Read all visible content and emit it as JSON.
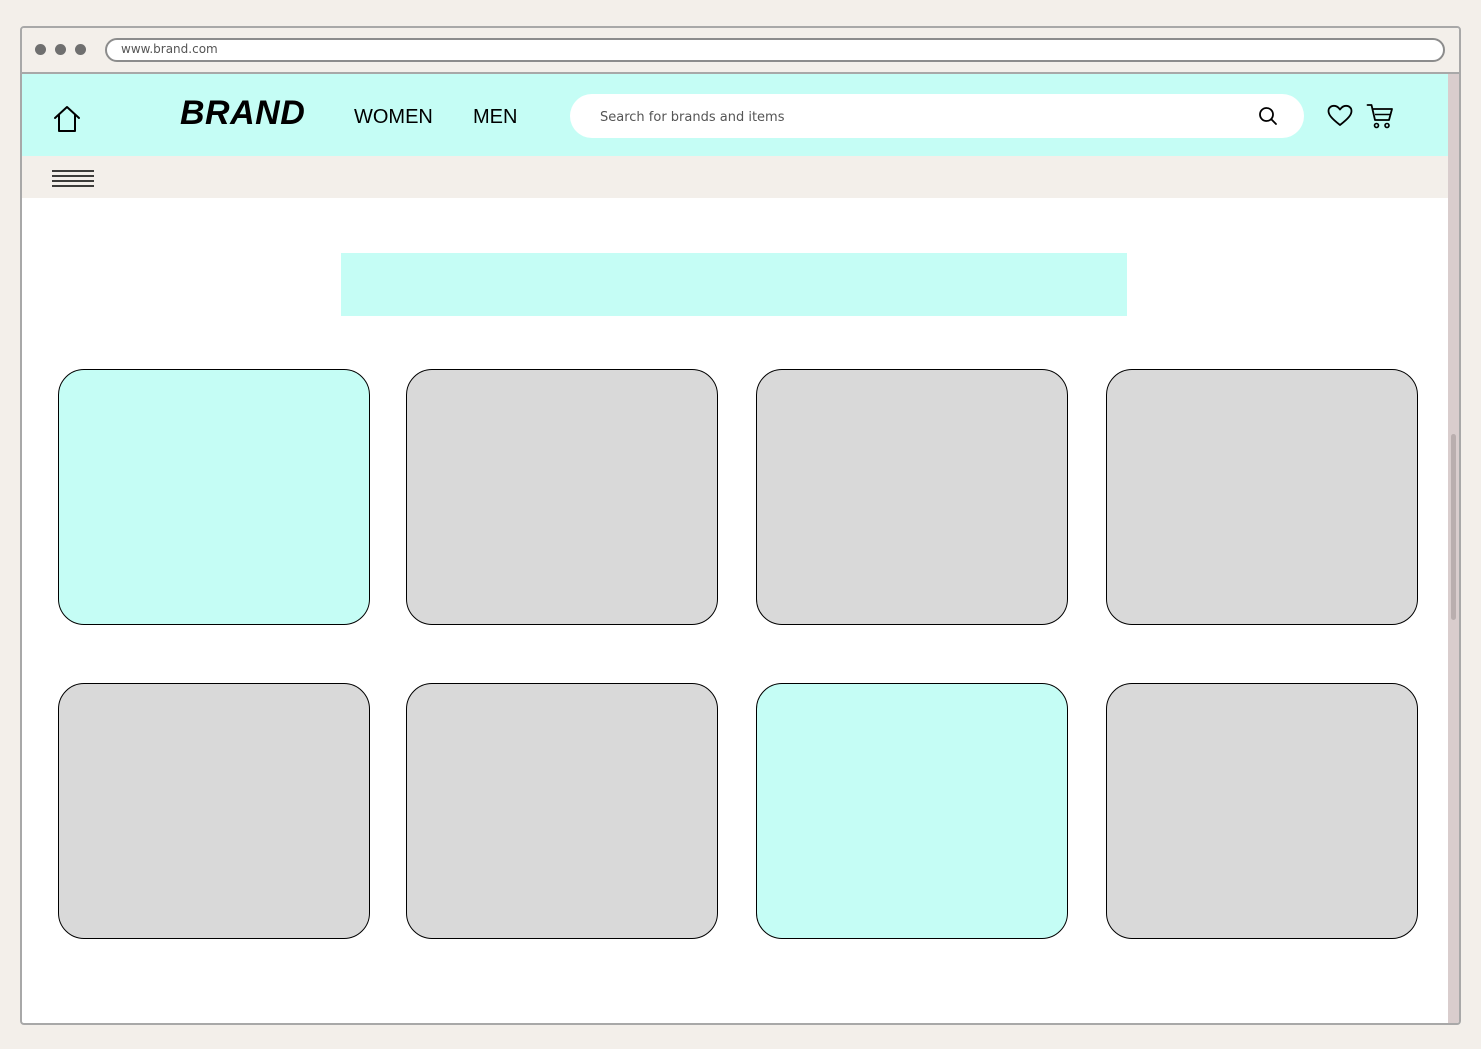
{
  "browser": {
    "url": "www.brand.com"
  },
  "header": {
    "logo": "BRAND",
    "nav": [
      "WOMEN",
      "MEN"
    ],
    "search_placeholder": "Search for brands and items"
  },
  "colors": {
    "accent": "#c5fdf5",
    "card": "#d9d9d9",
    "background": "#f3efea"
  },
  "products": [
    {
      "highlighted": true
    },
    {
      "highlighted": false
    },
    {
      "highlighted": false
    },
    {
      "highlighted": false
    },
    {
      "highlighted": false
    },
    {
      "highlighted": false
    },
    {
      "highlighted": true
    },
    {
      "highlighted": false
    }
  ],
  "icons": [
    "home-icon",
    "search-icon",
    "heart-icon",
    "cart-icon",
    "menu-icon"
  ]
}
